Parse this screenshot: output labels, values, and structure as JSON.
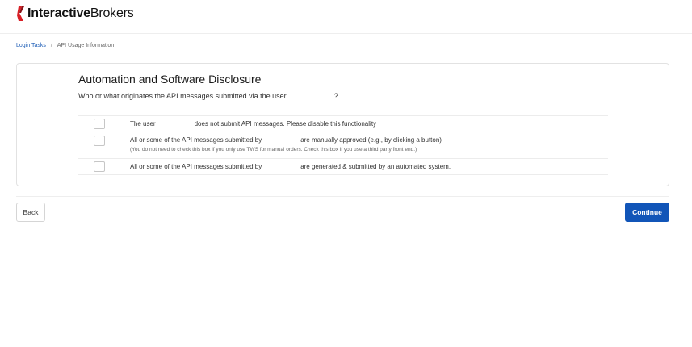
{
  "header": {
    "logo_text_bold": "Interactive",
    "logo_text_regular": "Brokers",
    "brand_color": "#d81f26"
  },
  "breadcrumb": {
    "items": [
      "Login Tasks",
      "API Usage Information"
    ],
    "separator": "/"
  },
  "card": {
    "title": "Automation and Software Disclosure",
    "question_prefix": "Who or what originates the API messages submitted via the user",
    "question_suffix": "?",
    "options": [
      {
        "text_before": "The user",
        "text_after": "does not submit API messages. Please disable this functionality",
        "checked": false
      },
      {
        "text_before": "All or some of the API messages submitted by",
        "text_after": "are manually approved (e.g., by clicking a button)",
        "note": "(You do not need to check this box if you only use TWS for manual orders. Check this box if you use a third party front end.)",
        "checked": false
      },
      {
        "text_before": "All or some of the API messages submitted by",
        "text_after": "are generated & submitted by an automated system.",
        "checked": false
      }
    ]
  },
  "footer": {
    "back_label": "Back",
    "continue_label": "Continue",
    "accent_color": "#1155b8"
  }
}
